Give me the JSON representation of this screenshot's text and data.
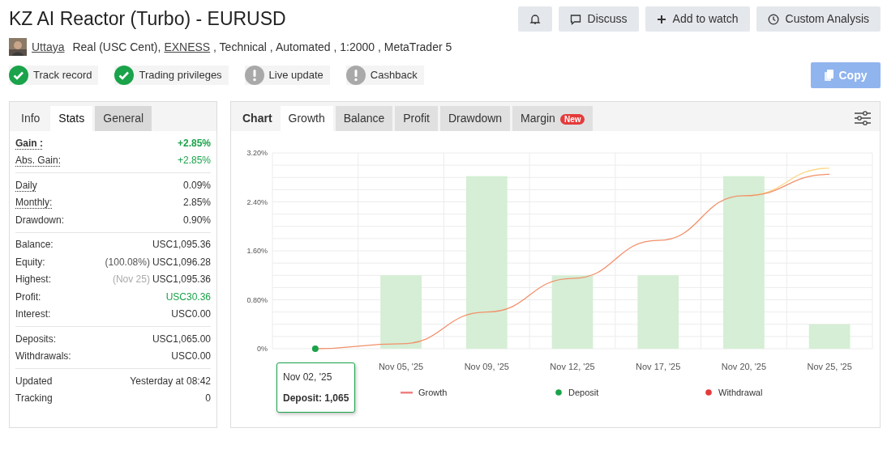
{
  "title": "KZ AI Reactor (Turbo) - EURUSD",
  "header_buttons": [
    {
      "kind": "bell"
    },
    {
      "label": "Discuss",
      "kind": "comment"
    },
    {
      "label": "Add to watch",
      "kind": "plus"
    },
    {
      "label": "Custom Analysis",
      "kind": "clock"
    }
  ],
  "owner": {
    "name": "Uttaya",
    "account": "Real (USC Cent),",
    "broker": "EXNESS",
    "details": ", Technical , Automated , 1:2000 , MetaTrader 5"
  },
  "badges": [
    {
      "label": "Track record",
      "verified": true
    },
    {
      "label": "Trading privileges",
      "verified": true
    },
    {
      "label": "Live update",
      "verified": false
    },
    {
      "label": "Cashback",
      "verified": false
    }
  ],
  "copy_button": {
    "label": "Copy",
    "disabled": true
  },
  "side_tabs": [
    {
      "label": "Info",
      "selected": false,
      "highlighted": false
    },
    {
      "label": "Stats",
      "selected": true,
      "highlighted": false
    },
    {
      "label": "General",
      "selected": false,
      "highlighted": true
    }
  ],
  "stats": [
    [
      {
        "label": "Gain :",
        "value": "+2.85%",
        "positive": true,
        "bold": true,
        "dotted": true
      },
      {
        "label": "Abs. Gain:",
        "value": "+2.85%",
        "positive": true,
        "bold": false,
        "dotted": true
      }
    ],
    [
      {
        "label": "Daily",
        "value": "0.09%",
        "positive": false,
        "bold": false,
        "dotted": true
      },
      {
        "label": "Monthly:",
        "value": "2.85%",
        "positive": false,
        "bold": false,
        "dotted": true
      },
      {
        "label": "Drawdown:",
        "value": "0.90%",
        "positive": false,
        "bold": false,
        "dotted": false
      }
    ],
    [
      {
        "label": "Balance:",
        "value": "USC1,095.36",
        "positive": false,
        "bold": false,
        "dotted": false
      },
      {
        "label": "Equity:",
        "note": "(100.08%)",
        "note_muted": false,
        "value": "USC1,096.28",
        "positive": false,
        "bold": false,
        "dotted": false
      },
      {
        "label": "Highest:",
        "note": "(Nov 25)",
        "note_muted": true,
        "value": "USC1,095.36",
        "positive": false,
        "bold": false,
        "dotted": false
      },
      {
        "label": "Profit:",
        "value": "USC30.36",
        "positive": true,
        "bold": false,
        "dotted": false
      },
      {
        "label": "Interest:",
        "value": "USC0.00",
        "positive": false,
        "bold": false,
        "dotted": false
      }
    ],
    [
      {
        "label": "Deposits:",
        "value": "USC1,065.00",
        "positive": false,
        "bold": false,
        "dotted": false
      },
      {
        "label": "Withdrawals:",
        "value": "USC0.00",
        "positive": false,
        "bold": false,
        "dotted": false
      }
    ],
    [
      {
        "label": "Updated",
        "value": "Yesterday at 08:42",
        "positive": false,
        "bold": false,
        "dotted": false
      },
      {
        "label": "Tracking",
        "value": "0",
        "positive": false,
        "bold": false,
        "dotted": false
      }
    ]
  ],
  "chart_panel": {
    "label": "Chart",
    "tabs": [
      {
        "label": "Growth",
        "selected": true
      },
      {
        "label": "Balance",
        "selected": false
      },
      {
        "label": "Profit",
        "selected": false
      },
      {
        "label": "Drawdown",
        "selected": false
      },
      {
        "label": "Margin",
        "selected": false,
        "badge": "New"
      }
    ],
    "chart_data": {
      "type": "bar",
      "categories": [
        null,
        "Nov 05, '25",
        "Nov 09, '25",
        "Nov 12, '25",
        "Nov 17, '25",
        "Nov 20, '25",
        "Nov 25, '25"
      ],
      "grid": true,
      "ylim": [
        0,
        3.2
      ],
      "yticks": [
        {
          "value": 0,
          "label": "0%"
        },
        {
          "value": 0.8,
          "label": "0.80%"
        },
        {
          "value": 1.6,
          "label": "1.60%"
        },
        {
          "value": 2.4,
          "label": "2.40%"
        },
        {
          "value": 3.2,
          "label": "3.20%"
        }
      ],
      "series": [
        {
          "type": "bar",
          "color": "#d5eed5",
          "values": [
            null,
            1.2,
            2.82,
            1.2,
            1.2,
            2.82,
            0.4
          ]
        },
        {
          "type": "line",
          "color": "#fcd98a",
          "values": [
            null,
            null,
            null,
            null,
            null,
            2.5,
            2.95
          ]
        },
        {
          "type": "line",
          "color": "#f2906a",
          "values": [
            0,
            0.08,
            0.6,
            1.15,
            1.77,
            2.5,
            2.85
          ]
        },
        {
          "type": "scatter",
          "color": "#1aa34a",
          "values": [
            0,
            null,
            null,
            null,
            null,
            null,
            null
          ]
        }
      ]
    },
    "legend": [
      {
        "label": "Growth",
        "kind": "line",
        "color": "#f08080"
      },
      {
        "label": "Deposit",
        "kind": "dot",
        "color": "#1aa34a"
      },
      {
        "label": "Withdrawal",
        "kind": "dot",
        "color": "#e53a3a"
      }
    ],
    "tooltip": {
      "date": "Nov 02, '25",
      "text": "Deposit: 1,065"
    }
  }
}
